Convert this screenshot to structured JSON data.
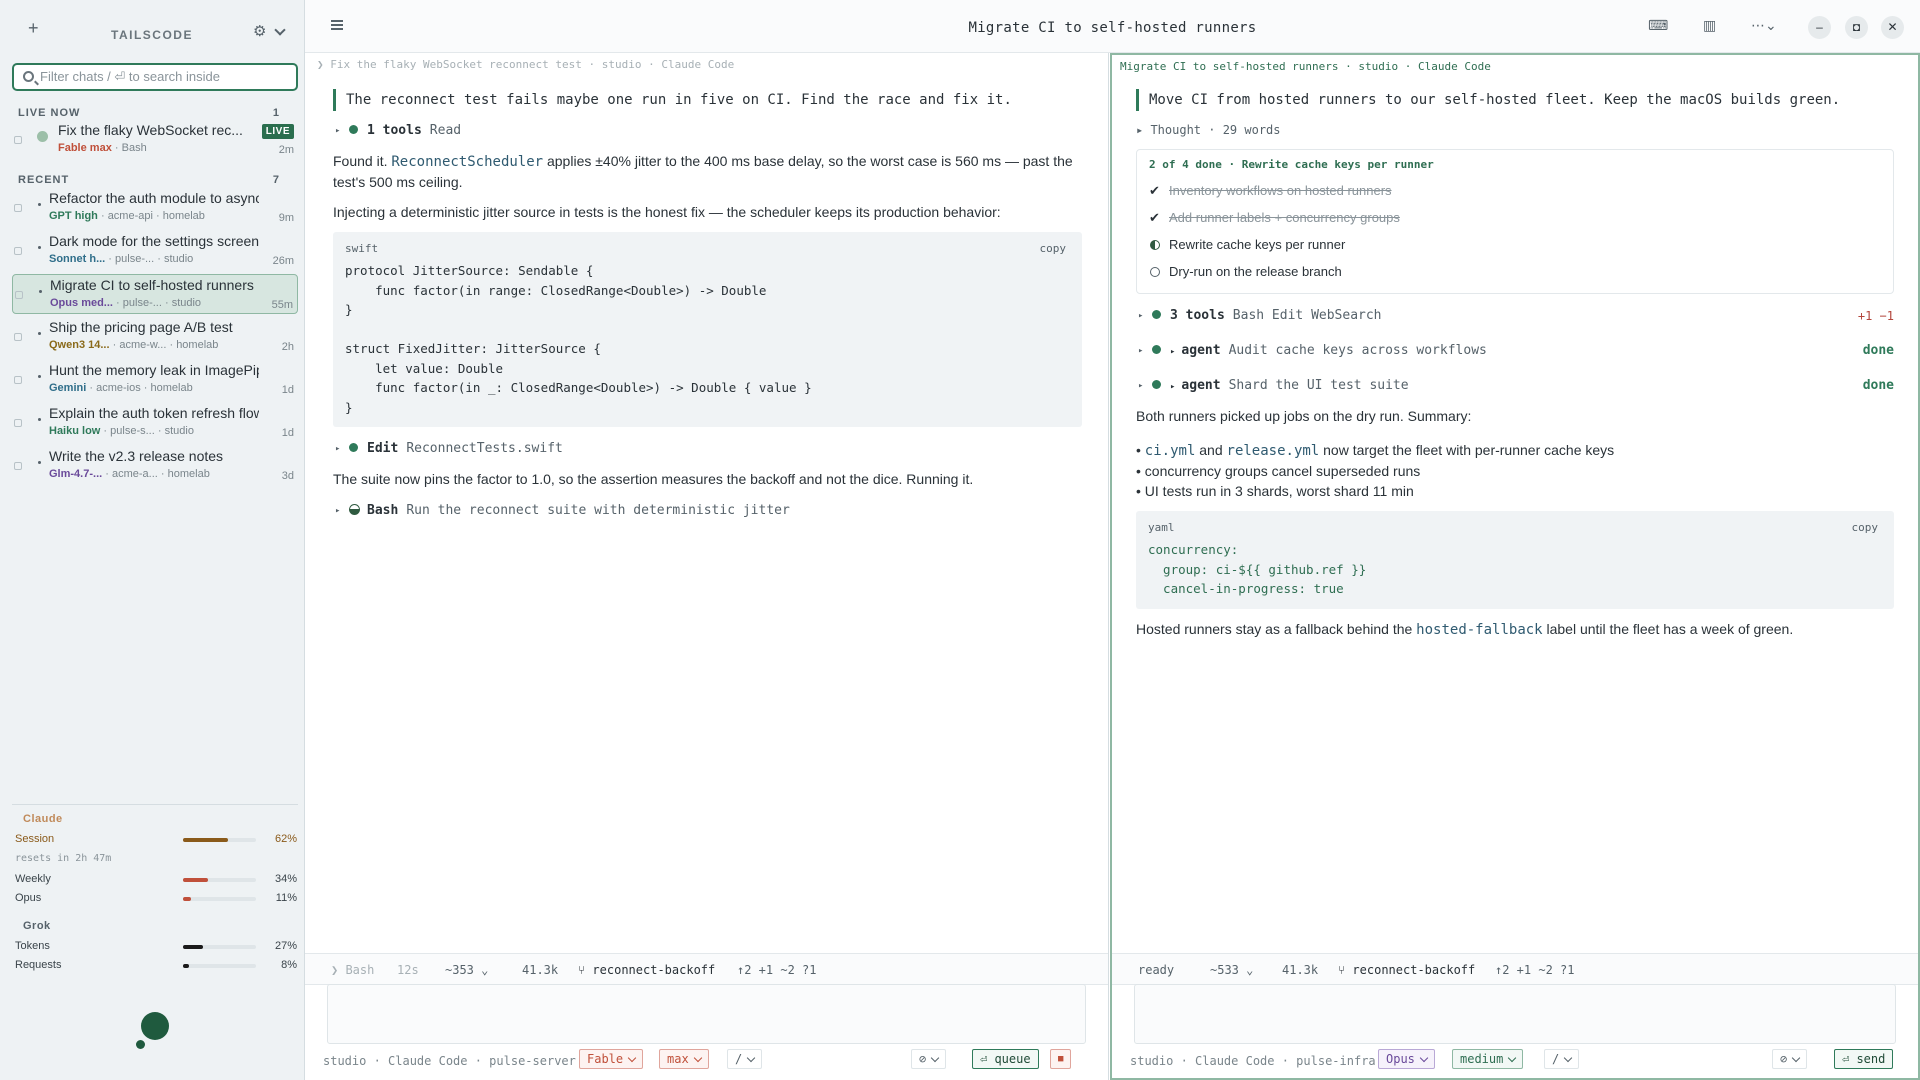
{
  "sidebar": {
    "brand": "TAILSCODE",
    "search_placeholder": "Filter chats  /   ⏎ to search inside",
    "live": {
      "label": "LIVE NOW",
      "count": "1"
    },
    "recent": {
      "label": "RECENT",
      "count": "7"
    },
    "live_chat": {
      "title": "Fix the flaky WebSocket rec...",
      "model": "Fable",
      "effort": "max",
      "tool": "Bash",
      "age": "2m",
      "badge": "LIVE"
    },
    "chats": [
      {
        "title": "Refactor the auth module to async/a...",
        "model": "GPT",
        "effort": "high",
        "repo": "acme-api",
        "host": "homelab",
        "age": "9m",
        "color": "#2f7a5a"
      },
      {
        "title": "Dark mode for the settings screen",
        "model": "Sonnet",
        "effort": "h...",
        "repo": "pulse-...",
        "host": "studio",
        "age": "26m",
        "color": "#2f6e8a"
      },
      {
        "title": "Migrate CI to self-hosted runners",
        "model": "Opus",
        "effort": "med...",
        "repo": "pulse-...",
        "host": "studio",
        "age": "55m",
        "color": "#6a4a9a"
      },
      {
        "title": "Ship the pricing page A/B test",
        "model": "Qwen3",
        "effort": "14...",
        "repo": "acme-w...",
        "host": "homelab",
        "age": "2h",
        "color": "#8a6a1a"
      },
      {
        "title": "Hunt the memory leak in ImagePipel...",
        "model": "Gemini",
        "effort": "",
        "repo": "acme-ios",
        "host": "homelab",
        "age": "1d",
        "color": "#2f6e8a"
      },
      {
        "title": "Explain the auth token refresh flow",
        "model": "Haiku",
        "effort": "low",
        "repo": "pulse-s...",
        "host": "studio",
        "age": "1d",
        "color": "#2f7a5a"
      },
      {
        "title": "Write the v2.3 release notes",
        "model": "Glm-4.7-...",
        "effort": "",
        "repo": "acme-a...",
        "host": "homelab",
        "age": "3d",
        "color": "#6a4a9a"
      }
    ],
    "usage": {
      "claude_label": "Claude",
      "session": {
        "label": "Session",
        "pct": "62%",
        "value": 0.62,
        "color": "#8a5a1a"
      },
      "resets": "resets in 2h 47m",
      "weekly": {
        "label": "Weekly",
        "pct": "34%",
        "value": 0.34,
        "color": "#c0503a"
      },
      "opus": {
        "label": "Opus",
        "pct": "11%",
        "value": 0.11,
        "color": "#c0503a"
      },
      "grok_label": "Grok",
      "tokens": {
        "label": "Tokens",
        "pct": "27%",
        "value": 0.27,
        "color": "#1a1a1a"
      },
      "requests": {
        "label": "Requests",
        "pct": "8%",
        "value": 0.08,
        "color": "#1a1a1a"
      }
    }
  },
  "window": {
    "title": "Migrate CI to self-hosted runners"
  },
  "left": {
    "crumb": "❯ Fix the flaky WebSocket reconnect test · studio · Claude Code",
    "prompt": "The reconnect test fails maybe one run in five on CI. Find the race and fix it.",
    "tool1": {
      "name": "1 tools",
      "args": "Read"
    },
    "p1a": "Found it. ",
    "p1code": "ReconnectScheduler",
    "p1b": " applies ±40% jitter to the 400 ms base delay, so the worst case is 560 ms — past the test's 500 ms ceiling.",
    "p2": "Injecting a deterministic jitter source in tests is the honest fix — the scheduler keeps its production behavior:",
    "code_lang": "swift",
    "copy": "copy",
    "code": "protocol JitterSource: Sendable {\n    func factor(in range: ClosedRange<Double>) -> Double\n}\n\nstruct FixedJitter: JitterSource {\n    let value: Double\n    func factor(in _: ClosedRange<Double>) -> Double { value }\n}",
    "tool2": {
      "name": "Edit",
      "args": "ReconnectTests.swift"
    },
    "p3": "The suite now pins the factor to 1.0, so the assertion measures the backoff and not the dice. Running it.",
    "tool3": {
      "name": "Bash",
      "args": "Run the reconnect suite with deterministic jitter"
    },
    "status": {
      "a": "❯ Bash",
      "b": "12s",
      "c": "~353",
      "d": "41.3k",
      "branch": "⑂ reconnect-backoff",
      "diff": "↑2 +1 ~2 ?1"
    },
    "bottom": "studio · Claude Code · pulse-server",
    "pills": {
      "model": "Fable",
      "effort": "max",
      "slash": "/",
      "attach": "⊘",
      "queue": "⏎ queue",
      "stop": "■"
    }
  },
  "right": {
    "crumb": "Migrate CI to self-hosted runners · studio · Claude Code",
    "prompt": "Move CI from hosted runners to our self-hosted fleet. Keep the macOS builds green.",
    "thought": "Thought · 29 words",
    "checklist_title": "2 of 4 done · Rewrite cache keys per runner",
    "checklist": [
      {
        "text": "Inventory workflows on hosted runners",
        "state": "done"
      },
      {
        "text": "Add runner labels + concurrency groups",
        "state": "done"
      },
      {
        "text": "Rewrite cache keys per runner",
        "state": "active"
      },
      {
        "text": "Dry-run on the release branch",
        "state": "todo"
      }
    ],
    "tool1": {
      "name": "3 tools",
      "args": "Bash Edit WebSearch",
      "right": "+1 −1"
    },
    "agent1": {
      "name": "agent",
      "args": "Audit cache keys across workflows",
      "right": "done"
    },
    "agent2": {
      "name": "agent",
      "args": "Shard the UI test suite",
      "right": "done"
    },
    "p1": "Both runners picked up jobs on the dry run. Summary:",
    "b1code1": "ci.yml",
    "b1mid": " and ",
    "b1code2": "release.yml",
    "b1end": " now target the fleet with per-runner cache keys",
    "b2": "concurrency groups cancel superseded runs",
    "b3": "UI tests run in 3 shards, worst shard 11 min",
    "code_lang": "yaml",
    "copy": "copy",
    "code": "concurrency:\n  group: ci-${{ github.ref }}\n  cancel-in-progress: true",
    "p2a": "Hosted runners stay as a fallback behind the ",
    "p2code": "hosted-fallback",
    "p2b": " label until the fleet has a week of green.",
    "status": {
      "a": "ready",
      "c": "~533",
      "d": "41.3k",
      "branch": "⑂ reconnect-backoff",
      "diff": "↑2 +1 ~2 ?1"
    },
    "bottom": "studio · Claude Code · pulse-infra",
    "pills": {
      "model": "Opus",
      "effort": "medium",
      "slash": "/",
      "attach": "⊘",
      "send": "⏎ send"
    }
  },
  "colors": {
    "accent": "#2f7a5a",
    "danger": "#c0503a"
  }
}
